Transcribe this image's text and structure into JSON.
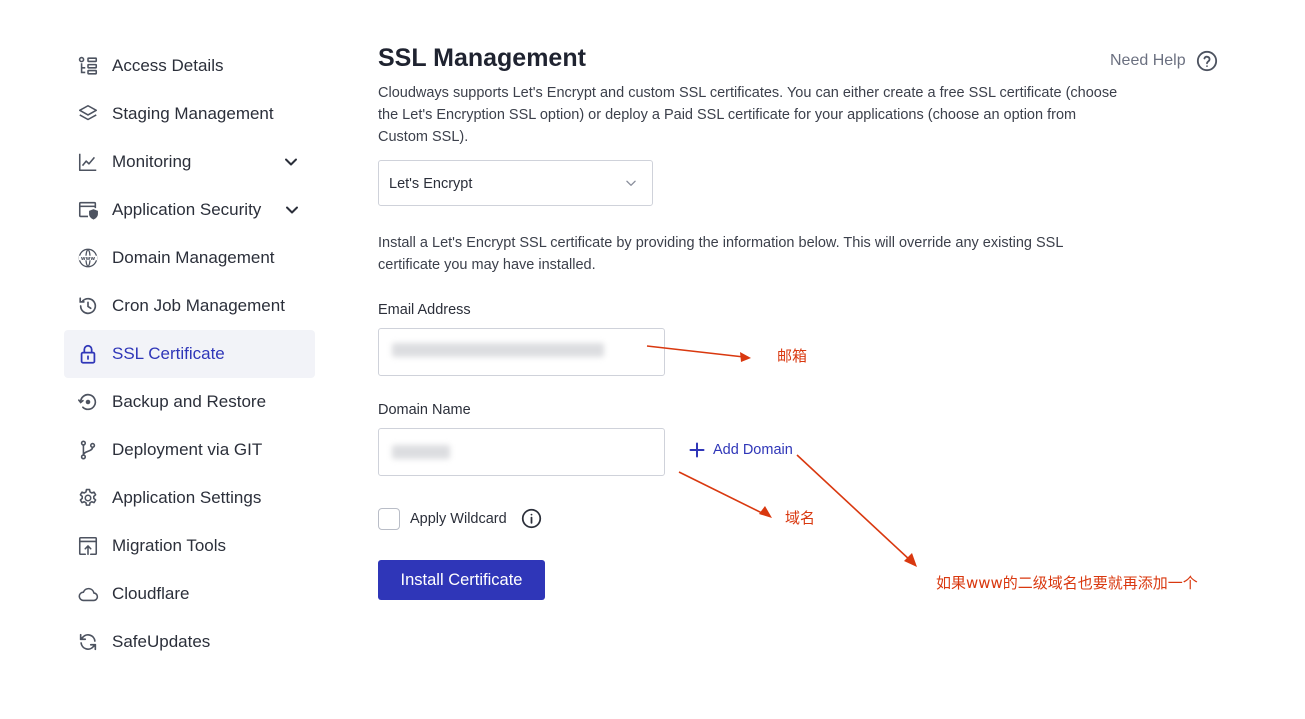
{
  "sidebar": {
    "items": [
      {
        "label": "Access Details",
        "icon": "list-details-icon"
      },
      {
        "label": "Staging Management",
        "icon": "layers-icon"
      },
      {
        "label": "Monitoring",
        "icon": "line-chart-icon",
        "has_chevron": true
      },
      {
        "label": "Application Security",
        "icon": "window-shield-icon",
        "has_chevron": true
      },
      {
        "label": "Domain Management",
        "icon": "www-globe-icon"
      },
      {
        "label": "Cron Job Management",
        "icon": "history-clock-icon"
      },
      {
        "label": "SSL Certificate",
        "icon": "lock-icon",
        "active": true
      },
      {
        "label": "Backup and Restore",
        "icon": "restore-icon"
      },
      {
        "label": "Deployment via GIT",
        "icon": "git-branch-icon"
      },
      {
        "label": "Application Settings",
        "icon": "gear-icon"
      },
      {
        "label": "Migration Tools",
        "icon": "upload-window-icon"
      },
      {
        "label": "Cloudflare",
        "icon": "cloud-icon"
      },
      {
        "label": "SafeUpdates",
        "icon": "refresh-icon"
      }
    ]
  },
  "main": {
    "title": "SSL Management",
    "help_label": "Need Help",
    "description": "Cloudways supports Let's Encrypt and custom SSL certificates. You can either create a free SSL certificate (choose the Let's Encryption SSL option) or deploy a Paid SSL certificate for your applications (choose an option from Custom SSL).",
    "ssl_type_selected": "Let's Encrypt",
    "install_info": "Install a Let's Encrypt SSL certificate by providing the information below. This will override any existing SSL certificate you may have installed.",
    "email_label": "Email Address",
    "email_value": "",
    "domain_label": "Domain Name",
    "domain_value": "",
    "add_domain_label": "Add Domain",
    "wildcard_label": "Apply Wildcard",
    "wildcard_checked": false,
    "install_button": "Install Certificate"
  },
  "annotations": {
    "email_note": "邮箱",
    "domain_note": "域名",
    "add_domain_note": "如果www的二级域名也要就再添加一个",
    "color": "#d9380f"
  },
  "colors": {
    "accent": "#2f36b8",
    "active_bg": "#f2f3f8"
  }
}
